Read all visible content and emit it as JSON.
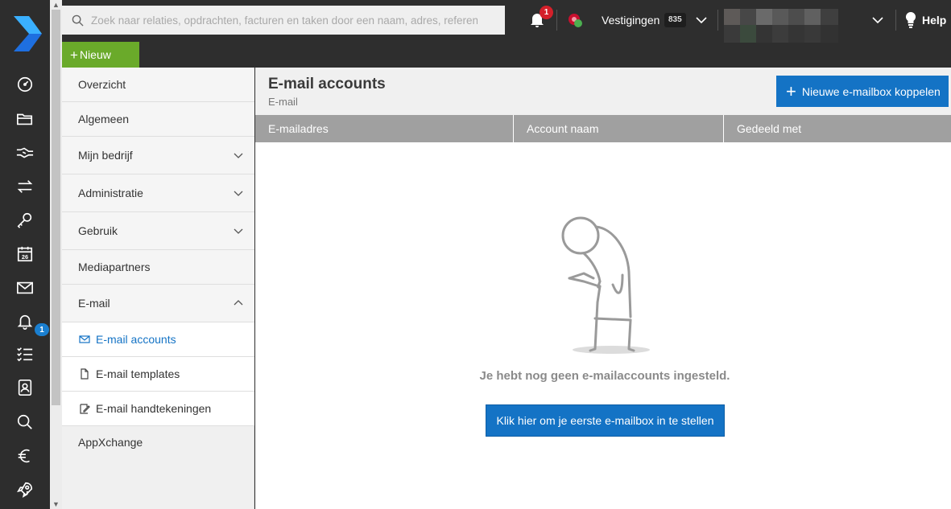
{
  "search": {
    "placeholder": "Zoek naar relaties, opdrachten, facturen en taken door een naam, adres, referentie of nummer"
  },
  "toolbar": {
    "new_label": "Nieuw"
  },
  "notifications": {
    "count": "1"
  },
  "locations": {
    "label": "Vestigingen",
    "count": "835"
  },
  "help": {
    "label": "Help"
  },
  "rail": {
    "items": [
      "dashboard-icon",
      "folder-icon",
      "handshake-icon",
      "transfer-icon",
      "key-icon",
      "calendar-icon",
      "mail-icon",
      "bell-icon",
      "checklist-icon",
      "contacts-icon",
      "search-icon",
      "euro-icon",
      "rocket-icon"
    ],
    "calendar_day": "26",
    "bell_badge": "1"
  },
  "settings_nav": {
    "overview": "Overzicht",
    "general": "Algemeen",
    "my_company": "Mijn bedrijf",
    "administration": "Administratie",
    "usage": "Gebruik",
    "media_partners": "Mediapartners",
    "email": "E-mail",
    "email_accounts": "E-mail accounts",
    "email_templates": "E-mail templates",
    "email_signatures": "E-mail handtekeningen",
    "appxchange": "AppXchange"
  },
  "main": {
    "title": "E-mail accounts",
    "subtitle": "E-mail",
    "connect_button": "Nieuwe e-mailbox koppelen",
    "columns": [
      "E-mailadres",
      "Account naam",
      "Gedeeld met"
    ],
    "empty_message": "Je hebt nog geen e-mailaccounts ingesteld.",
    "setup_button": "Klik hier om je eerste e-mailbox in te stellen"
  },
  "colors": {
    "accent_blue": "#1473c5",
    "new_green": "#6aaa2a",
    "badge_red": "#d4202a",
    "rail_dark": "#2d2d2d"
  }
}
